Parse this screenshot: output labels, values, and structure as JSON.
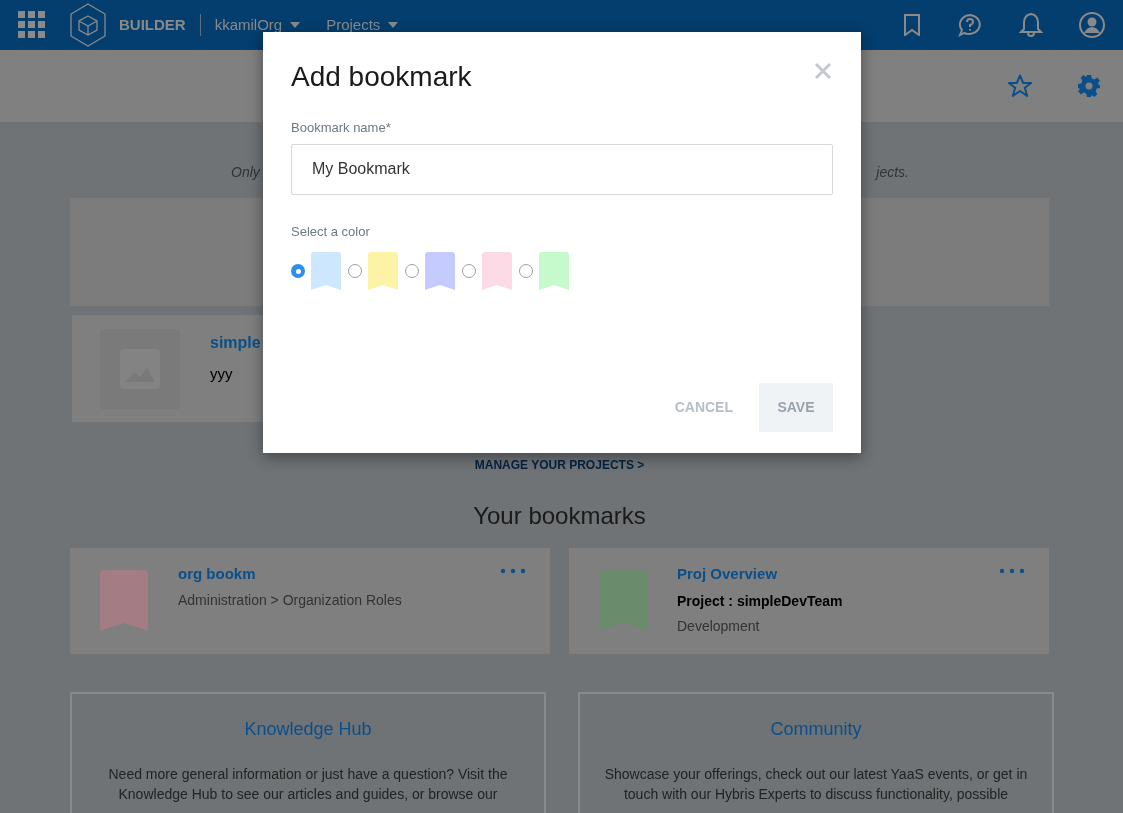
{
  "header": {
    "product": "BUILDER",
    "org": "kkamilOrg",
    "projects_menu": "Projects"
  },
  "intro": {
    "left": "Only",
    "right": "jects."
  },
  "projects": [
    {
      "title": "simple",
      "description": "yyy"
    }
  ],
  "manage_link": "MANAGE YOUR PROJECTS >",
  "bookmarks_heading": "Your bookmarks",
  "bookmarks": [
    {
      "title": "org bookm",
      "color": "#a37d83",
      "lines": [
        {
          "text": "Administration > Organization Roles",
          "bold": false
        }
      ]
    },
    {
      "title": "Proj Overview",
      "color": "#6a8c6c",
      "lines": [
        {
          "text": "Project : simpleDevTeam",
          "bold": true
        },
        {
          "text": "Development",
          "bold": false
        }
      ]
    }
  ],
  "info_cards": [
    {
      "title": "Knowledge Hub",
      "text": "Need more general information or just have a question? Visit the Knowledge Hub to see our articles and guides, or browse our"
    },
    {
      "title": "Community",
      "text": "Showcase your offerings, check out our latest YaaS events, or get in touch with our Hybris Experts to discuss functionality, possible"
    }
  ],
  "dialog": {
    "title": "Add bookmark",
    "name_label": "Bookmark name*",
    "name_value": "My Bookmark",
    "color_label": "Select a color",
    "colors": [
      {
        "color": "#cce7ff",
        "selected": true
      },
      {
        "color": "#fdf3a7",
        "selected": false
      },
      {
        "color": "#c5cbff",
        "selected": false
      },
      {
        "color": "#fddbe6",
        "selected": false
      },
      {
        "color": "#c6f9cb",
        "selected": false
      }
    ],
    "buttons": [
      {
        "label": "CANCEL",
        "kind": "text"
      },
      {
        "label": "SAVE",
        "kind": "filled"
      }
    ]
  }
}
